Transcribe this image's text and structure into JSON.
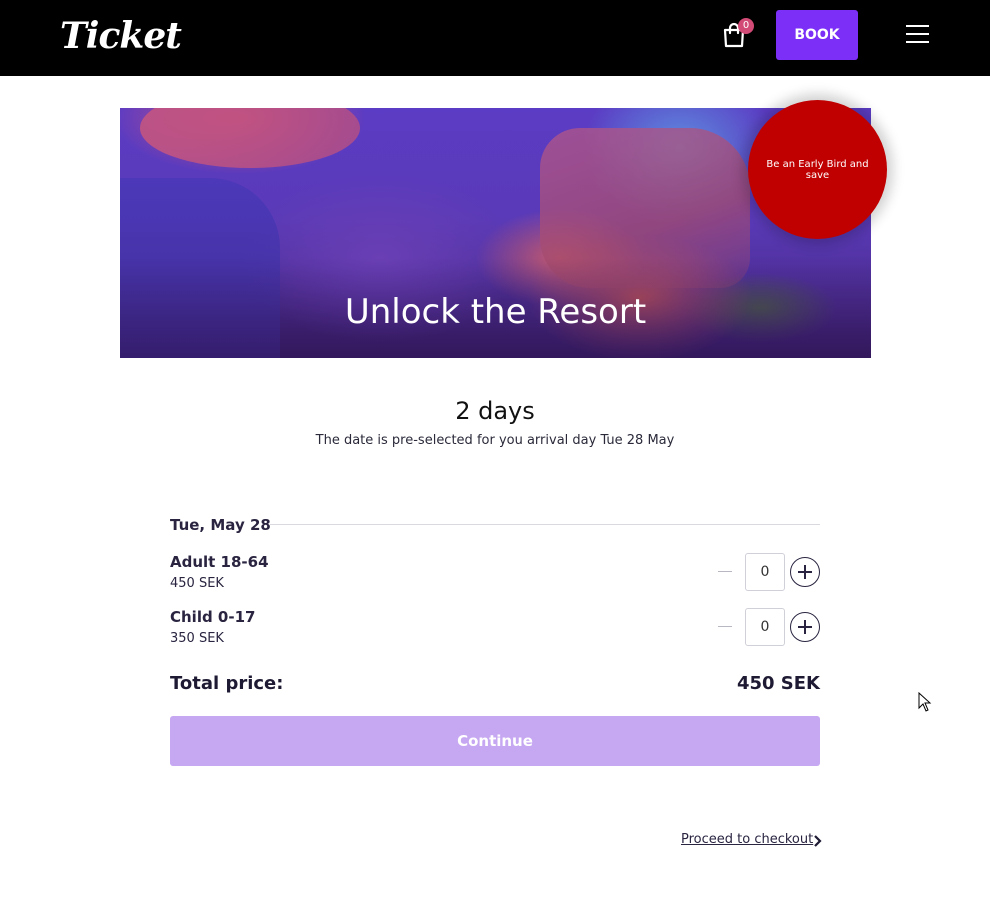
{
  "header": {
    "logo_text": "Ticket",
    "cart": {
      "count": "0",
      "icon": "shopping-bag-icon"
    },
    "book_label": "BOOK",
    "menu_icon": "hamburger-menu-icon"
  },
  "hero": {
    "title": "Unlock the Resort",
    "badge_text": "Be an Early Bird and save",
    "badge_color": "#c00000"
  },
  "summary": {
    "duration": "2 days",
    "note": "The date is pre-selected for you arrival day Tue 28 May"
  },
  "booking": {
    "date_label": "Tue, May 28",
    "tickets": [
      {
        "name": "Adult 18-64",
        "price": "450 SEK",
        "quantity": "0"
      },
      {
        "name": "Child 0-17",
        "price": "350 SEK",
        "quantity": "0"
      }
    ],
    "total_label": "Total price:",
    "total_value": "450 SEK",
    "continue_label": "Continue",
    "checkout_link": "Proceed to checkout"
  },
  "colors": {
    "header_bg": "#000000",
    "accent": "#7b2ff7",
    "continue_disabled": "#c6a7f2",
    "badge": "#d24b76"
  }
}
